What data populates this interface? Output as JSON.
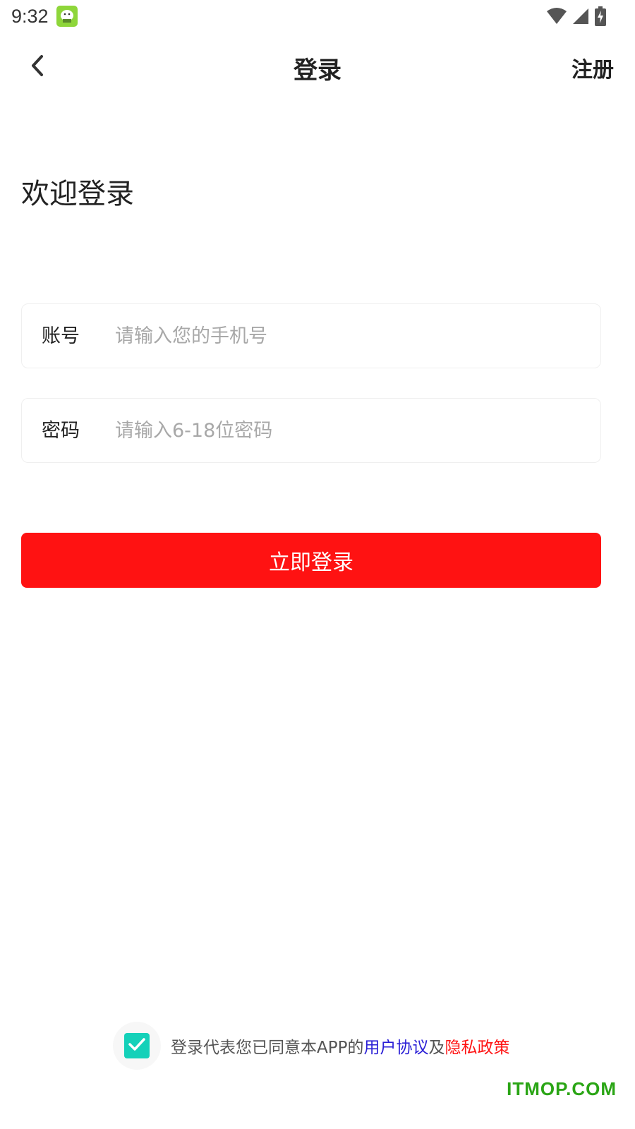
{
  "status_bar": {
    "time": "9:32",
    "icons": [
      "app-notification-icon",
      "wifi-icon",
      "cell-signal-icon",
      "battery-charging-icon"
    ]
  },
  "nav": {
    "back_icon": "chevron-left-icon",
    "title": "登录",
    "register_label": "注册"
  },
  "welcome_text": "欢迎登录",
  "account_field": {
    "label": "账号",
    "placeholder": "请输入您的手机号",
    "value": ""
  },
  "password_field": {
    "label": "密码",
    "placeholder": "请输入6-18位密码",
    "value": ""
  },
  "login_button_label": "立即登录",
  "agreement": {
    "checked": true,
    "prefix": "登录代表您已同意本APP的",
    "user_agreement": "用户协议",
    "connector": "及",
    "privacy_policy": "隐私政策"
  },
  "watermark": "ITMOP.COM",
  "colors": {
    "primary_red": "#ff1212",
    "checkbox_teal": "#14d1b9",
    "link_blue": "#2a1fd6",
    "watermark_green": "#2aa515"
  }
}
